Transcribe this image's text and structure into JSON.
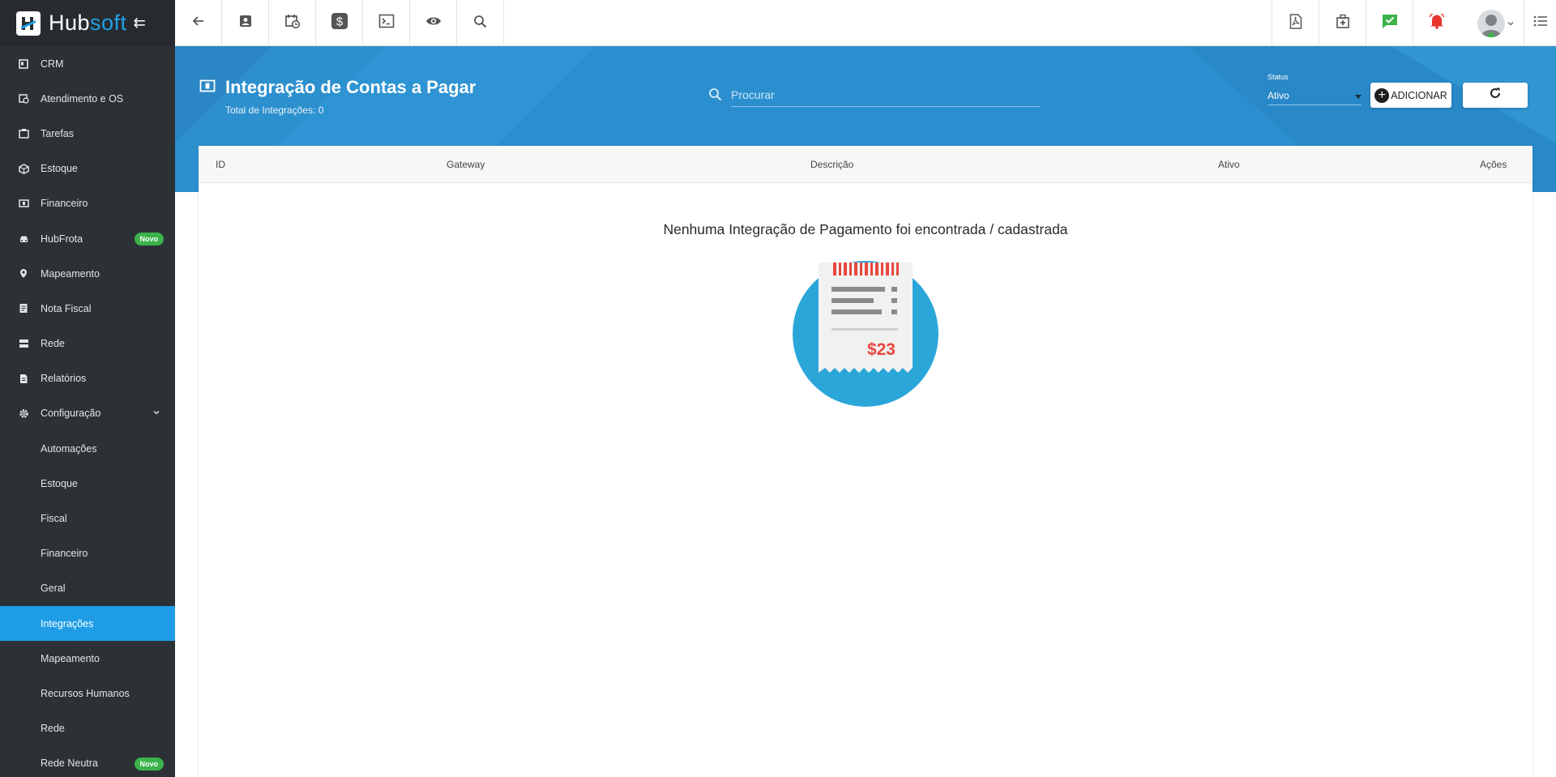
{
  "brand": {
    "name_part1": "Hub",
    "name_part2": "soft",
    "collapse_glyph": "⇇"
  },
  "sidebar": {
    "items": [
      {
        "label": "CRM",
        "icon": "crm-icon"
      },
      {
        "label": "Atendimento e OS",
        "icon": "service-icon"
      },
      {
        "label": "Tarefas",
        "icon": "tasks-icon"
      },
      {
        "label": "Estoque",
        "icon": "box-icon"
      },
      {
        "label": "Financeiro",
        "icon": "money-icon"
      },
      {
        "label": "HubFrota",
        "icon": "car-icon",
        "badge": "Novo"
      },
      {
        "label": "Mapeamento",
        "icon": "map-pin-icon"
      },
      {
        "label": "Nota Fiscal",
        "icon": "invoice-icon"
      },
      {
        "label": "Rede",
        "icon": "network-icon"
      },
      {
        "label": "Relatórios",
        "icon": "report-icon"
      },
      {
        "label": "Configuração",
        "icon": "gear-icon",
        "expanded": true
      }
    ],
    "sub_items": [
      {
        "label": "Automações"
      },
      {
        "label": "Estoque"
      },
      {
        "label": "Fiscal"
      },
      {
        "label": "Financeiro"
      },
      {
        "label": "Geral"
      },
      {
        "label": "Integrações",
        "active": true
      },
      {
        "label": "Mapeamento"
      },
      {
        "label": "Recursos Humanos"
      },
      {
        "label": "Rede"
      },
      {
        "label": "Rede Neutra",
        "badge": "Novo"
      }
    ]
  },
  "topbar": {
    "left_icons": [
      "back-arrow-icon",
      "contact-card-icon",
      "calendar-clock-icon",
      "dollar-icon",
      "terminal-icon",
      "eye-icon",
      "search-icon"
    ],
    "right_icons": [
      "pdf-icon",
      "hospital-icon",
      "chat-check-icon",
      "alarm-bell-icon",
      "user-avatar",
      "menu-list-icon"
    ],
    "colors": {
      "chat_check": "#3bb34a",
      "alarm": "#e8332f"
    }
  },
  "header": {
    "title": "Integração de Contas a Pagar",
    "subtitle": "Total de Integrações: 0",
    "search_placeholder": "Procurar",
    "status_label": "Status",
    "status_value": "Ativo",
    "add_button": "ADICIONAR",
    "refresh_icon": "refresh-icon",
    "band_color": "#2b8fcf"
  },
  "table": {
    "columns": [
      "ID",
      "Gateway",
      "Descrição",
      "Ativo",
      "Ações"
    ],
    "empty_message": "Nenhuma Integração de Pagamento foi encontrada / cadastrada"
  },
  "illustration": {
    "receipt_amount": "$23",
    "circle_color": "#2ba6d9",
    "amount_color": "#e8483f"
  },
  "accent_color": "#1e9de6"
}
